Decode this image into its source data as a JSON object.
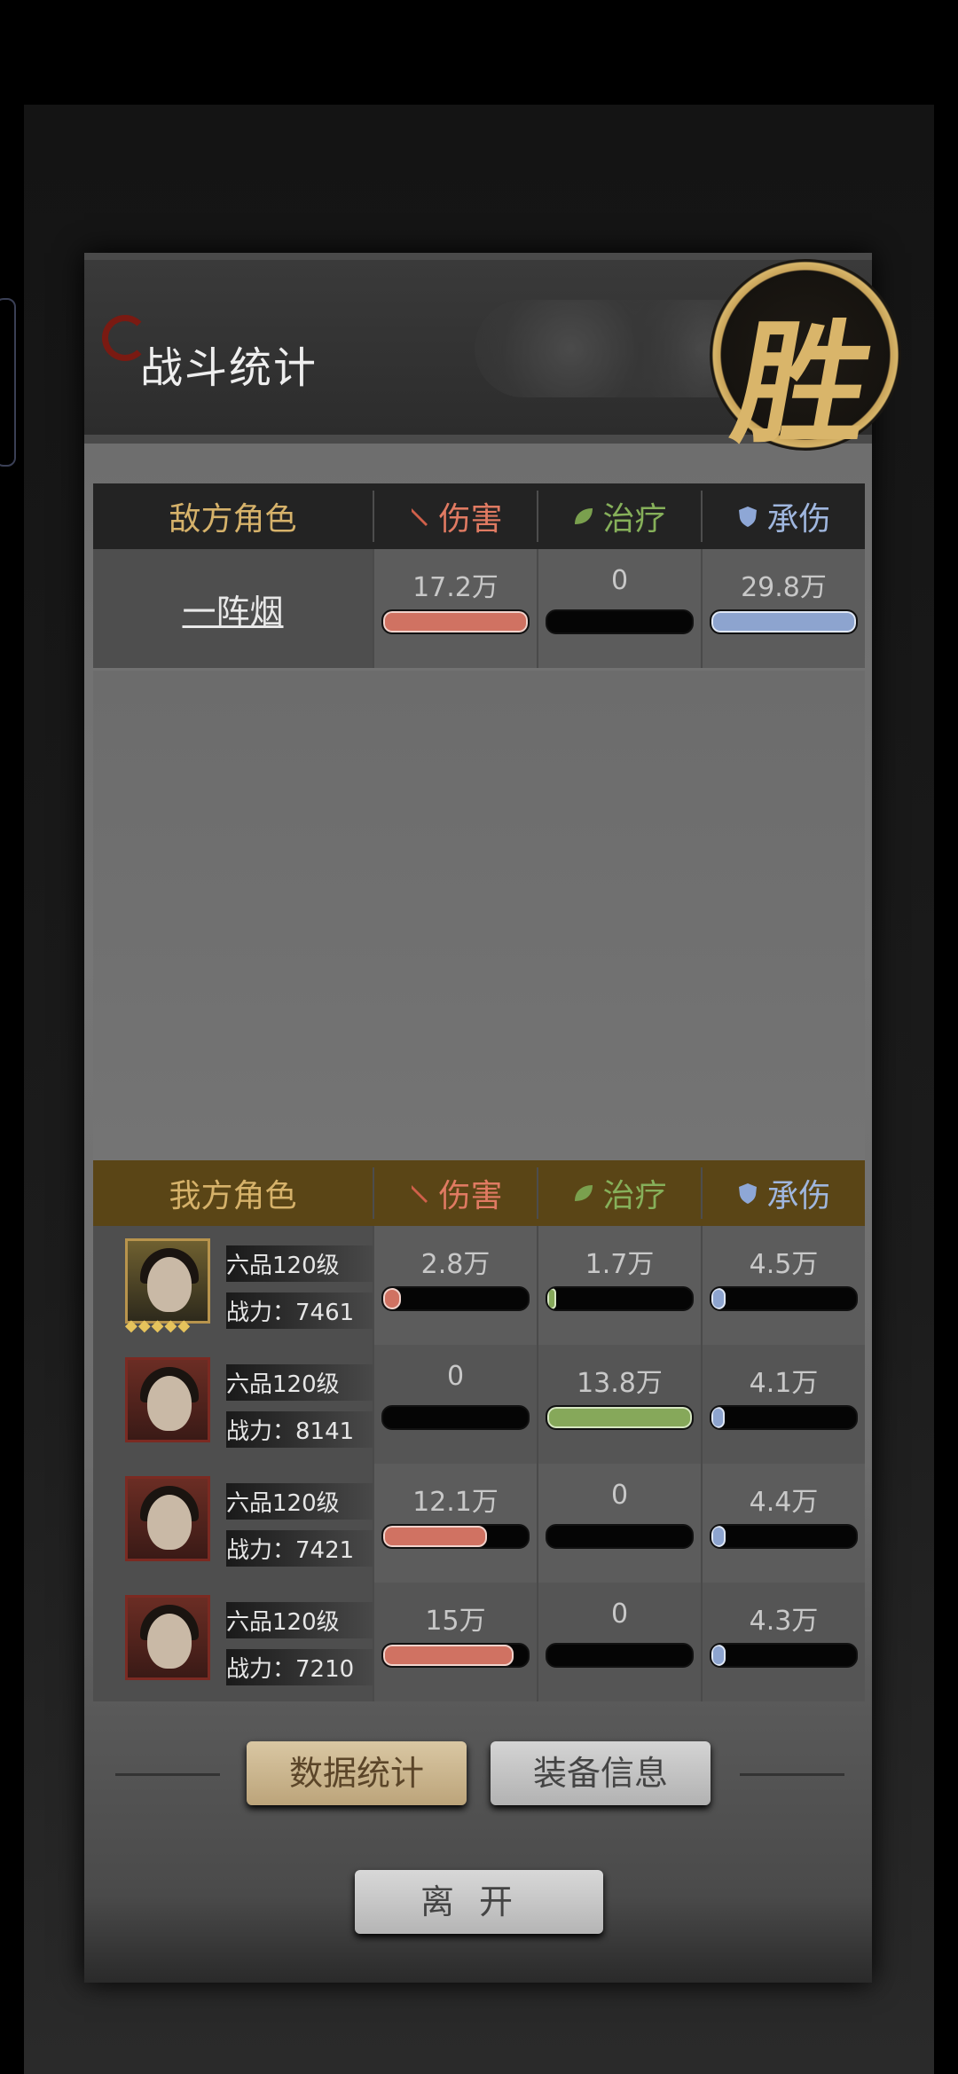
{
  "title": "战斗统计",
  "result_badge": "胜",
  "columns": {
    "damage": "伤害",
    "heal": "治疗",
    "tank": "承伤"
  },
  "enemy": {
    "header": "敌方角色",
    "rows": [
      {
        "name": "一阵烟",
        "damage": "17.2万",
        "damage_pct": 100,
        "heal": "0",
        "heal_pct": 0,
        "tank": "29.8万",
        "tank_pct": 100
      }
    ]
  },
  "ally": {
    "header": "我方角色",
    "rows": [
      {
        "level": "六品120级",
        "power_label": "战力：",
        "power": "7461",
        "damage": "2.8万",
        "damage_pct": 12,
        "heal": "1.7万",
        "heal_pct": 6,
        "tank": "4.5万",
        "tank_pct": 10,
        "stars": "◆◆◆◆◆"
      },
      {
        "level": "六品120级",
        "power_label": "战力：",
        "power": "8141",
        "damage": "0",
        "damage_pct": 0,
        "heal": "13.8万",
        "heal_pct": 100,
        "tank": "4.1万",
        "tank_pct": 9
      },
      {
        "level": "六品120级",
        "power_label": "战力：",
        "power": "7421",
        "damage": "12.1万",
        "damage_pct": 72,
        "heal": "0",
        "heal_pct": 0,
        "tank": "4.4万",
        "tank_pct": 10
      },
      {
        "level": "六品120级",
        "power_label": "战力：",
        "power": "7210",
        "damage": "15万",
        "damage_pct": 90,
        "heal": "0",
        "heal_pct": 0,
        "tank": "4.3万",
        "tank_pct": 10
      }
    ]
  },
  "buttons": {
    "stats": "数据统计",
    "equipment": "装备信息",
    "leave": "离开"
  },
  "colors": {
    "damage": "#d07262",
    "heal": "#86a85a",
    "tank": "#8da4cf",
    "gold": "#d6b26a"
  }
}
